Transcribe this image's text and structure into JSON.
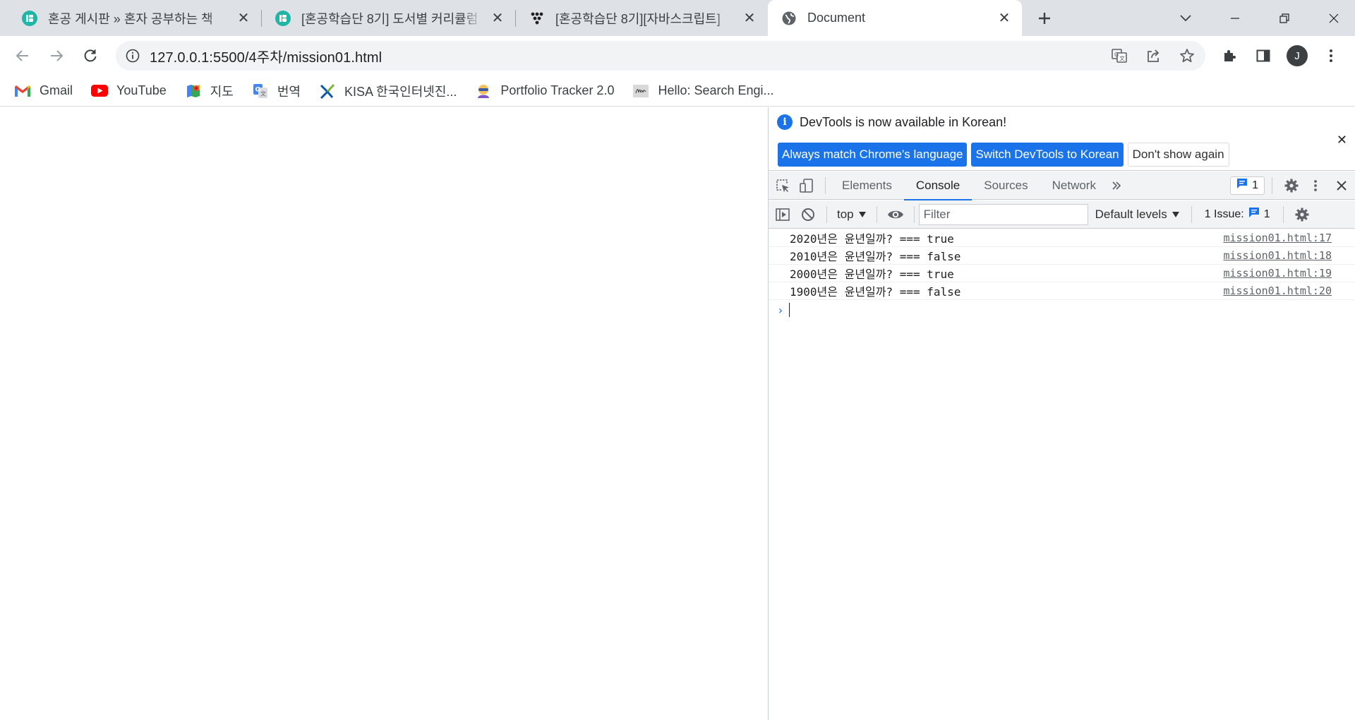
{
  "tabs": [
    {
      "title": "혼공 게시판 » 혼자 공부하는 책",
      "favicon": "hongong-logo-icon"
    },
    {
      "title": "[혼공학습단 8기] 도서별 커리큘럼",
      "favicon": "hongong-logo-icon"
    },
    {
      "title": "[혼공학습단 8기][자바스크립트]",
      "favicon": "dots-logo-icon"
    },
    {
      "title": "Document",
      "favicon": "globe-icon"
    }
  ],
  "address_bar": {
    "url": "127.0.0.1:5500/4주차/mission01.html"
  },
  "profile": {
    "initial": "J"
  },
  "bookmarks": [
    {
      "label": "Gmail",
      "icon": "gmail-icon"
    },
    {
      "label": "YouTube",
      "icon": "youtube-icon"
    },
    {
      "label": "지도",
      "icon": "maps-icon"
    },
    {
      "label": "번역",
      "icon": "translate-icon"
    },
    {
      "label": "KISA 한국인터넷진...",
      "icon": "kisa-icon"
    },
    {
      "label": "Portfolio Tracker 2.0",
      "icon": "portfolio-icon"
    },
    {
      "label": "Hello: Search Engi...",
      "icon": "hello-icon"
    }
  ],
  "devtools": {
    "infobar": {
      "message": "DevTools is now available in Korean!",
      "btn_match": "Always match Chrome's language",
      "btn_switch": "Switch DevTools to Korean",
      "btn_dismiss": "Don't show again"
    },
    "tabs": [
      {
        "label": "Elements"
      },
      {
        "label": "Console"
      },
      {
        "label": "Sources"
      },
      {
        "label": "Network"
      }
    ],
    "active_tab": "Console",
    "message_count": "1",
    "console_toolbar": {
      "context": "top",
      "filter_placeholder": "Filter",
      "levels": "Default levels",
      "issues_label": "1 Issue:",
      "issues_count": "1"
    },
    "logs": [
      {
        "message": "2020년은 윤년일까? === true",
        "source": "mission01.html:17"
      },
      {
        "message": "2010년은 윤년일까? === false",
        "source": "mission01.html:18"
      },
      {
        "message": "2000년은 윤년일까? === true",
        "source": "mission01.html:19"
      },
      {
        "message": "1900년은 윤년일까? === false",
        "source": "mission01.html:20"
      }
    ]
  },
  "colors": {
    "accent": "#1a73e8",
    "tabstrip_bg": "#dee1e6",
    "devtools_toolbar_bg": "#f1f3f4"
  }
}
